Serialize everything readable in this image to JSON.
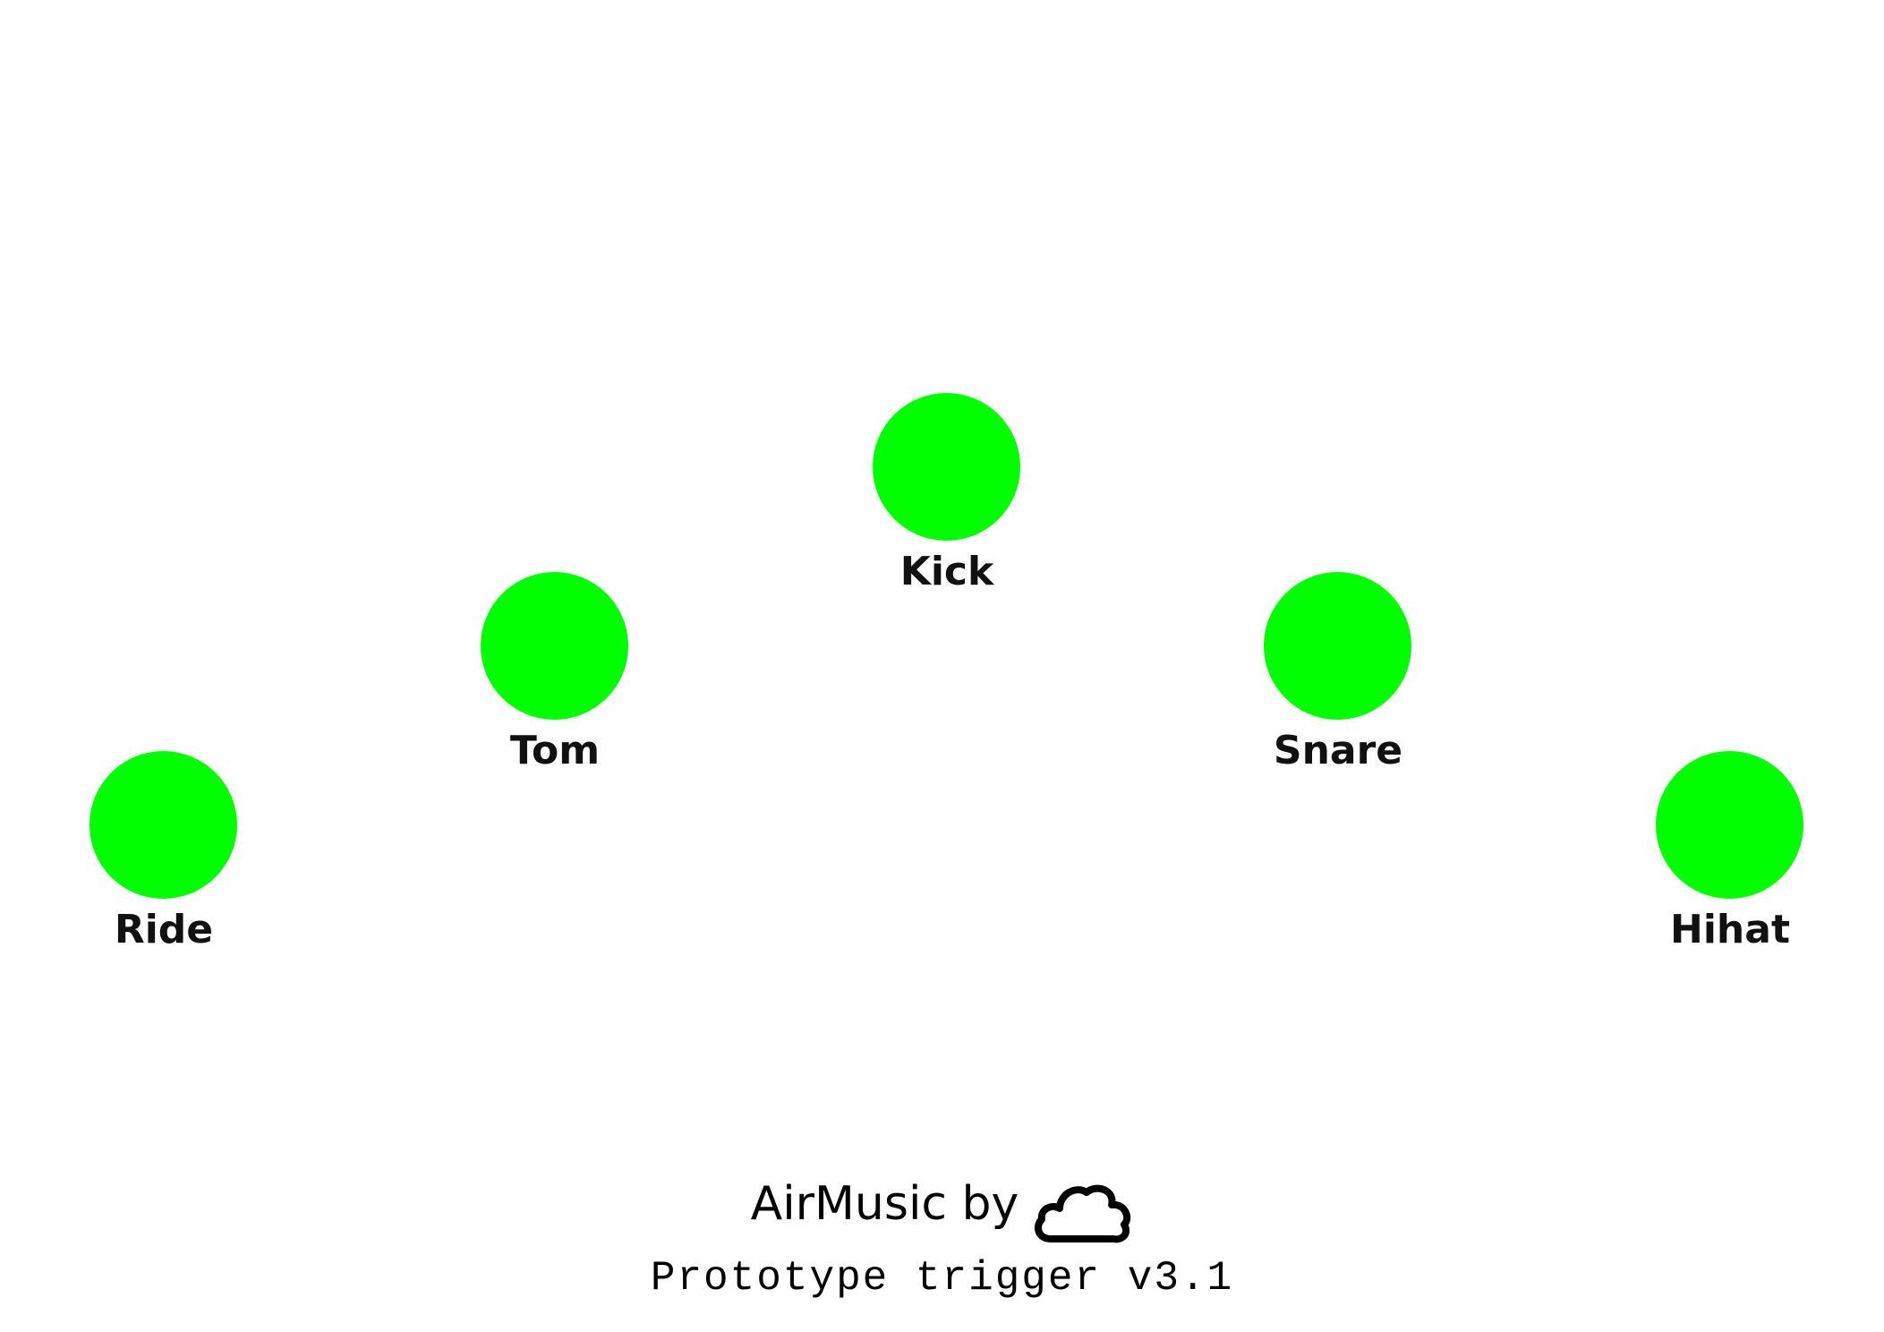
{
  "colors": {
    "pad_active": "#00ff00",
    "label": "#111111",
    "background": "#ffffff"
  },
  "pads": [
    {
      "id": "ride",
      "label": "Ride"
    },
    {
      "id": "tom",
      "label": "Tom"
    },
    {
      "id": "kick",
      "label": "Kick"
    },
    {
      "id": "snare",
      "label": "Snare"
    },
    {
      "id": "hihat",
      "label": "Hihat"
    }
  ],
  "footer": {
    "brand_text": "AirMusic by",
    "brand_icon": "cloud-icon",
    "version_text": "Prototype trigger v3.1"
  }
}
